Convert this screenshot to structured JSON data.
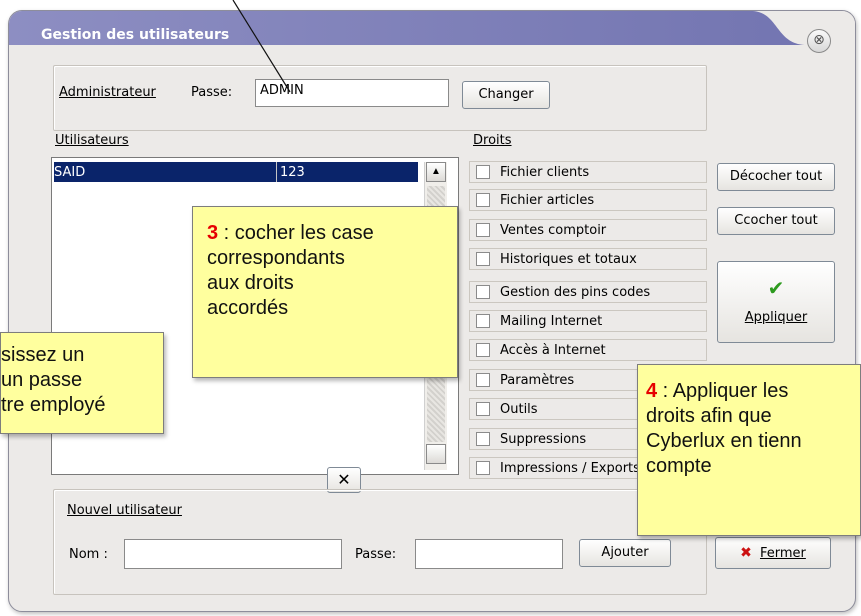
{
  "window": {
    "title": "Gestion des utilisateurs",
    "close_glyph": "⊗"
  },
  "admin": {
    "label": "Administrateur",
    "password_label": "Passe:",
    "password_value": "ADMIN",
    "change_button": "Changer"
  },
  "users": {
    "label": "Utilisateurs",
    "rows": [
      {
        "name": "SAID",
        "password": "123",
        "selected": true
      }
    ],
    "scroll_up_glyph": "▲",
    "clear_glyph": "✕"
  },
  "rights": {
    "label": "Droits",
    "items": [
      {
        "label": "Fichier clients",
        "checked": false
      },
      {
        "label": "Fichier articles",
        "checked": false
      },
      {
        "label": "Ventes comptoir",
        "checked": false
      },
      {
        "label": "Historiques et totaux",
        "checked": false
      },
      {
        "label": "Gestion des pins codes",
        "checked": false
      },
      {
        "label": "Mailing Internet",
        "checked": false
      },
      {
        "label": "Accès à Internet",
        "checked": false
      },
      {
        "label": "Paramètres",
        "checked": false
      },
      {
        "label": "Outils",
        "checked": false
      },
      {
        "label": "Suppressions",
        "checked": false
      },
      {
        "label": "Impressions / Exports",
        "checked": false
      }
    ]
  },
  "buttons": {
    "uncheck_all": "Décocher tout",
    "check_all": "Ccocher tout",
    "apply": "Appliquer",
    "apply_icon": "✔",
    "close": "Fermer",
    "close_icon": "✖"
  },
  "new_user": {
    "label": "Nouvel utilisateur",
    "name_label": "Nom :",
    "name_value": "",
    "password_label": "Passe:",
    "password_value": "",
    "add_button": "Ajouter"
  },
  "annotations": {
    "note2": {
      "line1": "sissez un",
      "line2": "un passe",
      "line3": "tre employé"
    },
    "note3": {
      "num": "3",
      "line1": " : cocher les case",
      "line2": "correspondants",
      "line3": "aux droits",
      "line4": "accordés"
    },
    "note4": {
      "num": "4",
      "line1": " : Appliquer les",
      "line2": "droits afin que",
      "line3": "Cyberlux en tienn",
      "line4": "compte"
    }
  },
  "colors": {
    "title_gradient_start": "#8d8ec2",
    "title_gradient_end": "#7779b3",
    "selection": "#0a246a",
    "note_background": "#ffff9e",
    "note_number": "#e60000",
    "apply_check": "#2d9a1e",
    "close_cross": "#cc1111"
  }
}
